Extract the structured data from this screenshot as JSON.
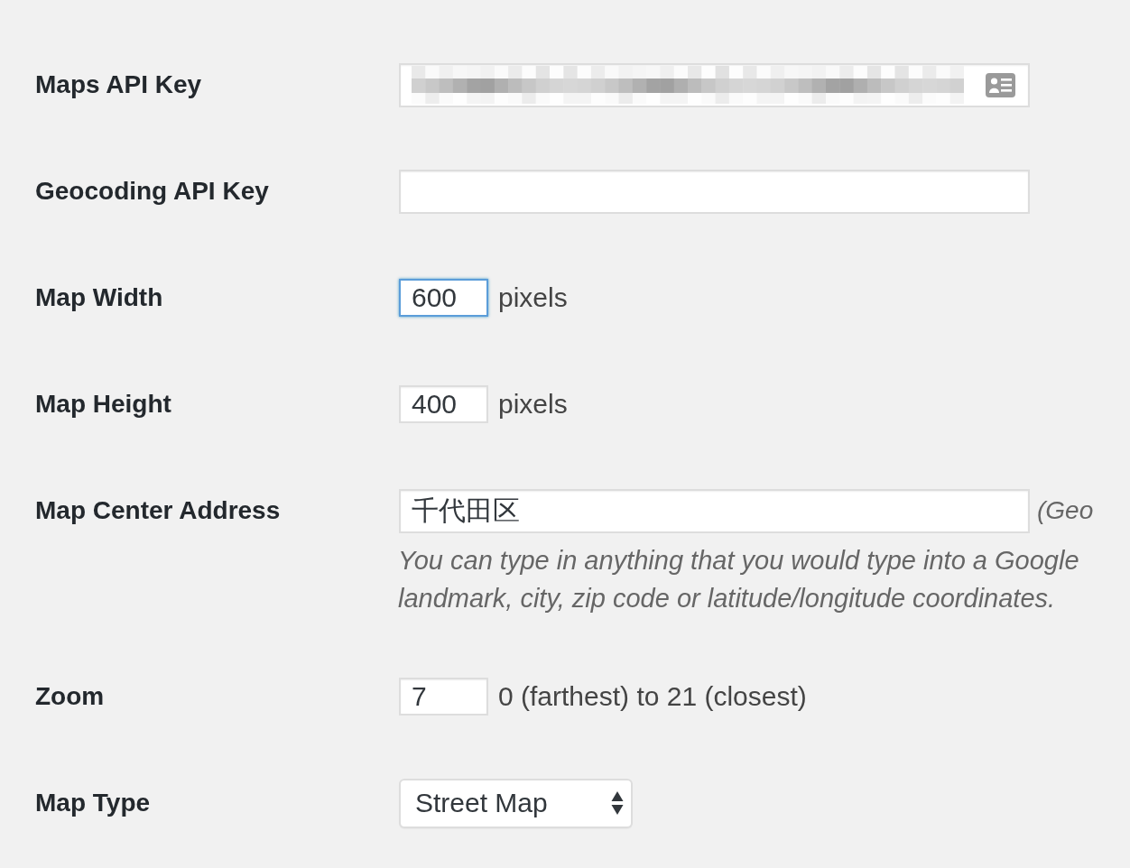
{
  "fields": [
    {
      "kind": "text",
      "label": "Maps API Key",
      "value_redacted": true,
      "autofill_icon": true,
      "focused": false
    },
    {
      "kind": "text",
      "label": "Geocoding API Key",
      "focused": false
    },
    {
      "kind": "number",
      "label": "Map Width",
      "value": "600",
      "suffix": "pixels",
      "focused": true
    },
    {
      "kind": "number",
      "label": "Map Height",
      "value": "400",
      "suffix": "pixels",
      "focused": false
    },
    {
      "kind": "text",
      "label": "Map Center Address",
      "value": "千代田区",
      "suffix": "(Geo",
      "description": [
        "You can type in anything that you would type into a Google",
        "landmark, city, zip code or latitude/longitude coordinates."
      ],
      "focused": false
    },
    {
      "kind": "number",
      "label": "Zoom",
      "value": "7",
      "suffix": "0 (farthest) to 21 (closest)",
      "focused": false
    },
    {
      "kind": "select",
      "label": "Map Type",
      "value": "Street Map",
      "focused": false
    }
  ]
}
